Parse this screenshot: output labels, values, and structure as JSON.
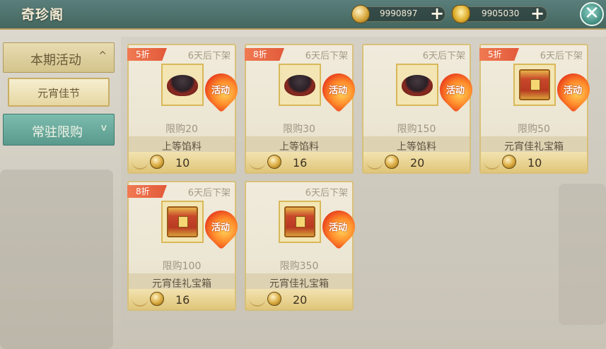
{
  "header": {
    "title": "奇珍阁",
    "currencies": [
      {
        "icon": "coin-icon",
        "value": "9990897"
      },
      {
        "icon": "ingot-icon",
        "value": "9905030"
      }
    ],
    "add_label": "+",
    "close_label": "✕"
  },
  "nav": {
    "current_event": {
      "label": "本期活动",
      "chevron": "^"
    },
    "event_sub": {
      "label": "元宵佳节"
    },
    "permanent": {
      "label": "常驻限购",
      "chevron": "v"
    }
  },
  "items": [
    {
      "discount": "5折",
      "expiry": "6天后下架",
      "icon": "bowl-icon",
      "event": "活动",
      "limit": "限购20",
      "name": "上等馅料",
      "price": "10"
    },
    {
      "discount": "8折",
      "expiry": "6天后下架",
      "icon": "bowl-icon",
      "event": "活动",
      "limit": "限购30",
      "name": "上等馅料",
      "price": "16"
    },
    {
      "discount": "",
      "expiry": "6天后下架",
      "icon": "bowl-icon",
      "event": "活动",
      "limit": "限购150",
      "name": "上等馅料",
      "price": "20"
    },
    {
      "discount": "5折",
      "expiry": "6天后下架",
      "icon": "chest-icon",
      "event": "活动",
      "limit": "限购50",
      "name": "元宵佳礼宝箱",
      "price": "10"
    },
    {
      "discount": "8折",
      "expiry": "6天后下架",
      "icon": "chest-icon",
      "event": "活动",
      "limit": "限购100",
      "name": "元宵佳礼宝箱",
      "price": "16"
    },
    {
      "discount": "",
      "expiry": "6天后下架",
      "icon": "chest-icon",
      "event": "活动",
      "limit": "限购350",
      "name": "元宵佳礼宝箱",
      "price": "20"
    }
  ]
}
